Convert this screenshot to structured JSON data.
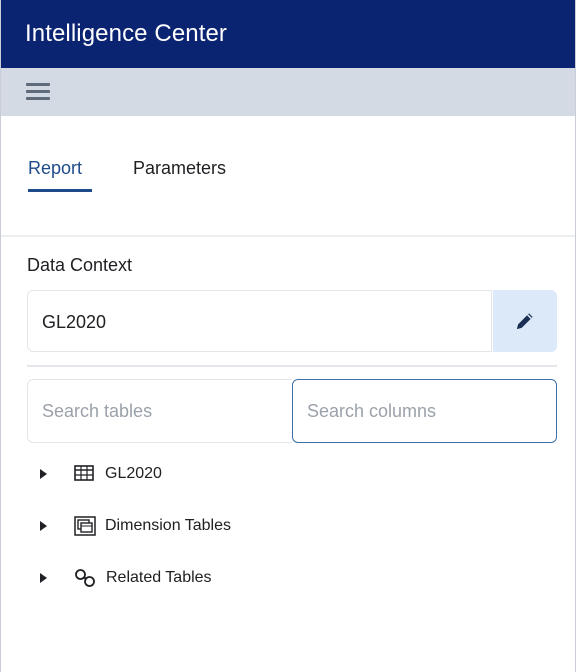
{
  "app": {
    "title": "Intelligence Center"
  },
  "toolbar": {
    "menu_icon": "hamburger-menu-icon"
  },
  "tabs": [
    {
      "label": "Report",
      "active": true
    },
    {
      "label": "Parameters",
      "active": false
    }
  ],
  "data_context": {
    "label": "Data Context",
    "value": "GL2020",
    "edit_icon": "pencil-icon"
  },
  "search": {
    "tables_placeholder": "Search tables",
    "columns_placeholder": "Search columns"
  },
  "tree": [
    {
      "label": "GL2020",
      "icon": "table-icon",
      "expanded": false
    },
    {
      "label": "Dimension Tables",
      "icon": "dimension-tables-icon",
      "expanded": false
    },
    {
      "label": "Related Tables",
      "icon": "link-icon",
      "expanded": false
    }
  ],
  "colors": {
    "header_bg": "#0a2472",
    "toolbar_bg": "#d3dae3",
    "accent": "#1f4b8a",
    "edit_button_bg": "#dbe9f9"
  }
}
